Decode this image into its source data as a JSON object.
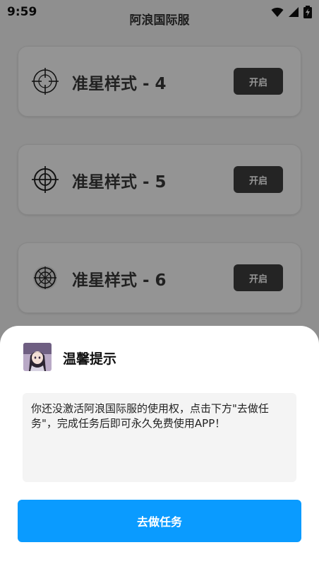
{
  "status_bar": {
    "time": "9:59",
    "icons": [
      "wifi-icon",
      "signal-icon",
      "battery-charging-icon"
    ]
  },
  "app": {
    "title": "阿浪国际服"
  },
  "cards": [
    {
      "label": "准星样式 - 4",
      "button": "开启",
      "icon": "crosshair-4-icon"
    },
    {
      "label": "准星样式 - 5",
      "button": "开启",
      "icon": "crosshair-5-icon"
    },
    {
      "label": "准星样式 - 6",
      "button": "开启",
      "icon": "crosshair-6-icon"
    }
  ],
  "dialog": {
    "title": "温馨提示",
    "message": "你还没激活阿浪国际服的使用权，点击下方\"去做任务\"，完成任务后即可永久免费使用APP！",
    "button": "去做任务",
    "avatar": "anime-girl-avatar"
  },
  "colors": {
    "primary_button": "#0a9bff",
    "card_button": "#3f3f3f"
  }
}
